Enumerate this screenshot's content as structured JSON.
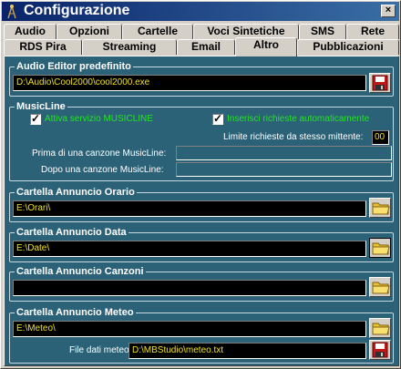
{
  "window": {
    "title": "Configurazione",
    "close_glyph": "×"
  },
  "tabs_row1": [
    {
      "label": "Audio"
    },
    {
      "label": "Opzioni"
    },
    {
      "label": "Cartelle"
    },
    {
      "label": "Voci Sintetiche"
    },
    {
      "label": "SMS"
    },
    {
      "label": "Rete"
    }
  ],
  "tabs_row2": [
    {
      "label": "RDS Pira"
    },
    {
      "label": "Streaming"
    },
    {
      "label": "Email"
    },
    {
      "label": "Altro"
    },
    {
      "label": "Pubblicazioni"
    }
  ],
  "active_tab": "Altro",
  "audio_editor": {
    "title": "Audio Editor predefinito",
    "value": "D:\\Audio\\Cool2000\\cool2000.exe"
  },
  "musicline": {
    "title": "MusicLine",
    "attiva_label": "Attiva servizio MUSICLINE",
    "attiva_checked": true,
    "inserisci_label": "Inserisci richieste automaticamente",
    "inserisci_checked": true,
    "limite_label": "Limite richieste da stesso mittente:",
    "limite_value": "00",
    "prima_label": "Prima di una canzone MusicLine:",
    "prima_value": "",
    "dopo_label": "Dopo una canzone MusicLine:",
    "dopo_value": ""
  },
  "orario": {
    "title": "Cartella Annuncio Orario",
    "value": "E:\\Orari\\"
  },
  "data": {
    "title": "Cartella Annuncio Data",
    "value": "E:\\Date\\"
  },
  "canzoni": {
    "title": "Cartella Annuncio Canzoni",
    "value": ""
  },
  "meteo": {
    "title": "Cartella Annuncio Meteo",
    "value": "E:\\Meteo\\",
    "file_label": "File dati meteo:",
    "file_value": "D:\\MBStudio\\meteo.txt"
  },
  "icons": {
    "save": "floppy-disk-icon",
    "folder": "folder-icon"
  },
  "colors": {
    "panel_bg": "#2b6278",
    "field_text": "#f0e020",
    "label_green": "#28e028",
    "titlebar": "#0a246a"
  }
}
